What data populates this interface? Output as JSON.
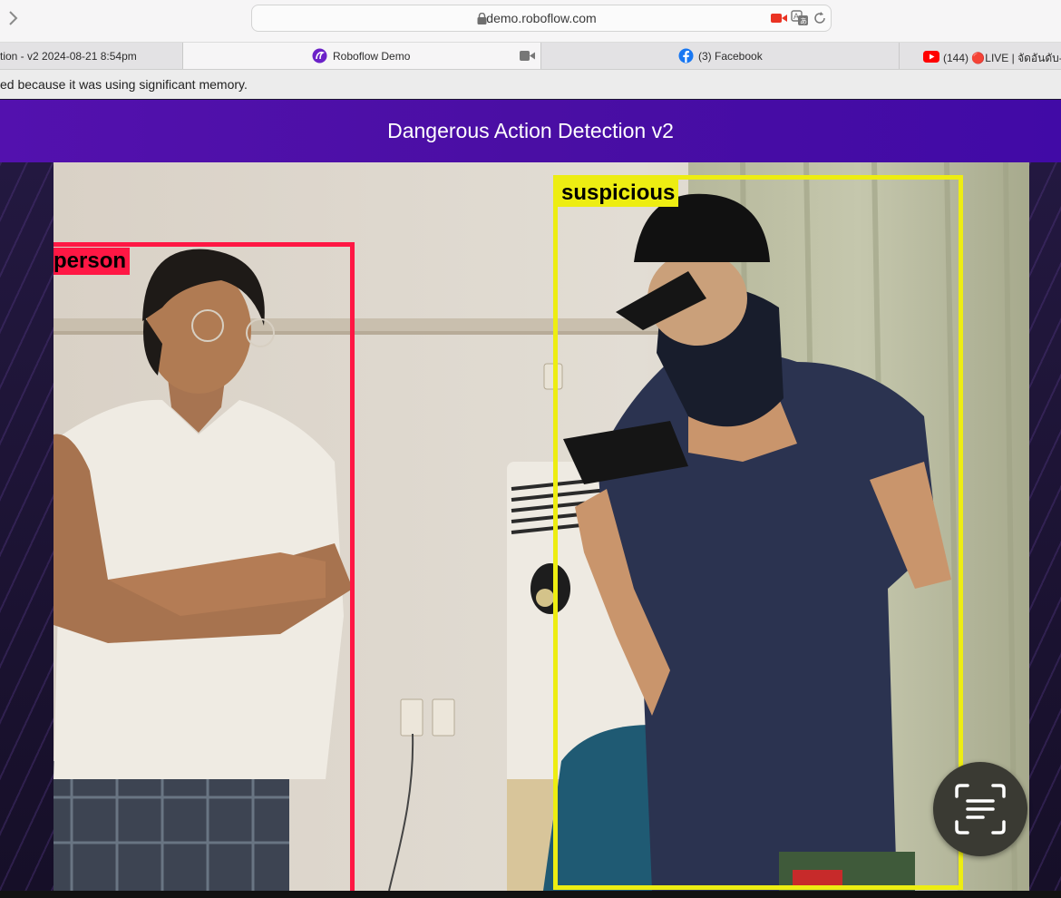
{
  "browser": {
    "url": "demo.roboflow.com",
    "tabs": [
      {
        "label": "tion - v2 2024-08-21 8:54pm",
        "active": false
      },
      {
        "label": "Roboflow Demo",
        "active": true
      },
      {
        "label": "(3) Facebook",
        "active": false
      },
      {
        "label": "(144) 🔴LIVE | จัดอันดับ-โ",
        "active": false
      }
    ],
    "infobar_text": "ed because it was using significant memory."
  },
  "page": {
    "title": "Dangerous Action Detection v2"
  },
  "detections": [
    {
      "label": "person",
      "color": "#ff1744"
    },
    {
      "label": "suspicious",
      "color": "#eded12"
    }
  ],
  "colors": {
    "header": "#4c0ea8",
    "person_box": "#ff1744",
    "suspicious_box": "#eded12"
  },
  "icons": [
    "chevron-right-icon",
    "lock-icon",
    "camera-recording-icon",
    "translate-icon",
    "reload-icon",
    "roboflow-logo-icon",
    "video-camera-icon",
    "facebook-icon",
    "youtube-icon",
    "scan-text-icon"
  ]
}
